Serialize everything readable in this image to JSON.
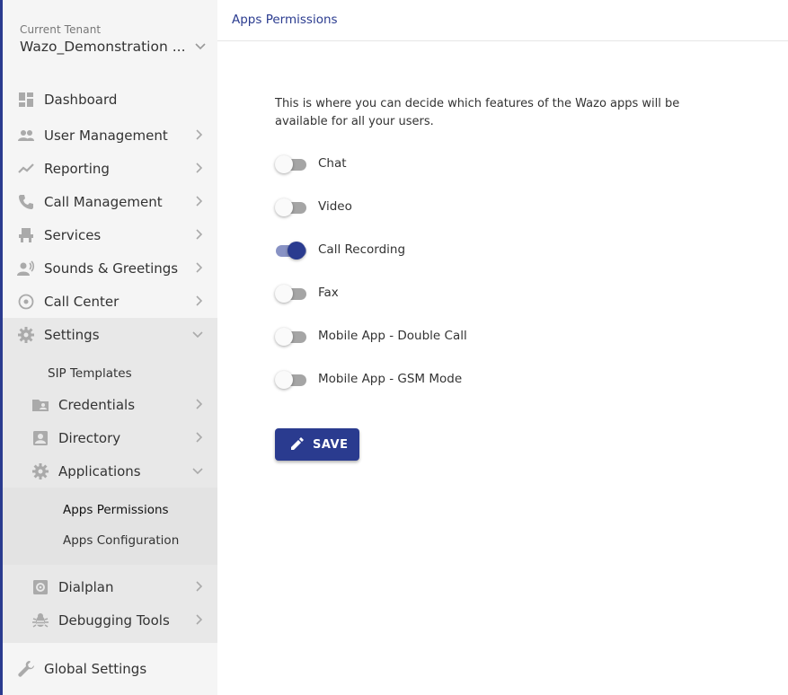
{
  "tenant": {
    "label": "Current Tenant",
    "name": "Wazo_Demonstration ..."
  },
  "nav": {
    "dashboard": "Dashboard",
    "user_management": "User Management",
    "reporting": "Reporting",
    "call_management": "Call Management",
    "services": "Services",
    "sounds_greetings": "Sounds & Greetings",
    "call_center": "Call Center",
    "settings": "Settings",
    "sip_templates": "SIP Templates",
    "credentials": "Credentials",
    "directory": "Directory",
    "applications": "Applications",
    "apps_permissions": "Apps Permissions",
    "apps_configuration": "Apps Configuration",
    "dialplan": "Dialplan",
    "debugging_tools": "Debugging Tools",
    "global_settings": "Global Settings"
  },
  "header": {
    "breadcrumb": "Apps Permissions"
  },
  "main": {
    "intro": "This is where you can decide which features of the Wazo apps will be available for all your users.",
    "permissions": [
      {
        "label": "Chat",
        "enabled": false
      },
      {
        "label": "Video",
        "enabled": false
      },
      {
        "label": "Call Recording",
        "enabled": true
      },
      {
        "label": "Fax",
        "enabled": false
      },
      {
        "label": "Mobile App - Double Call",
        "enabled": false
      },
      {
        "label": "Mobile App - GSM Mode",
        "enabled": false
      }
    ],
    "save_label": "SAVE"
  },
  "colors": {
    "primary": "#2a3b8f",
    "switch_on_track": "#8892c4",
    "sidebar_bg": "#f5f5f5"
  }
}
